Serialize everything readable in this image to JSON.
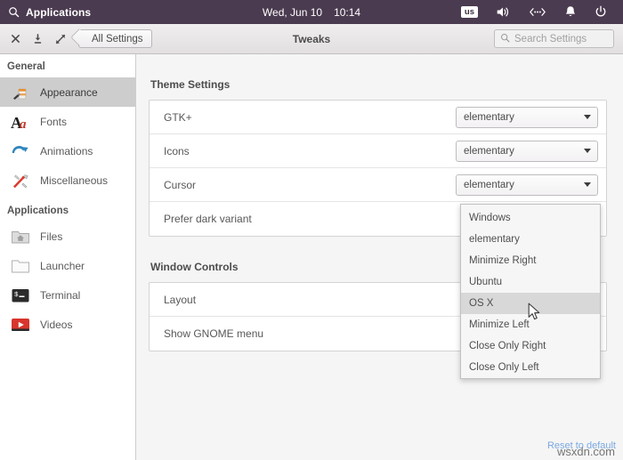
{
  "topbar": {
    "apps_icon": "search-icon",
    "apps_label": "Applications",
    "date": "Wed, Jun 10",
    "time": "10:14",
    "keyboard_layout": "us",
    "tray_icons": [
      "volume-icon",
      "network-icon",
      "bell-icon",
      "power-icon"
    ],
    "bg_color": "#4b3b50"
  },
  "titlebar": {
    "close_icon": "close-icon",
    "minimize_icon": "minimize-icon",
    "maximize_icon": "maximize-icon",
    "back_label": "All Settings",
    "title": "Tweaks",
    "search_placeholder": "Search Settings",
    "search_value": "",
    "search_icon": "search-icon"
  },
  "sidebar": {
    "groups": [
      {
        "heading": "General",
        "items": [
          {
            "label": "Appearance",
            "icon": "paintbrush-icon",
            "selected": true
          },
          {
            "label": "Fonts",
            "icon": "font-aa-icon",
            "selected": false
          },
          {
            "label": "Animations",
            "icon": "curved-arrow-icon",
            "selected": false
          },
          {
            "label": "Miscellaneous",
            "icon": "swiss-knife-icon",
            "selected": false
          }
        ]
      },
      {
        "heading": "Applications",
        "items": [
          {
            "label": "Files",
            "icon": "home-folder-icon",
            "selected": false
          },
          {
            "label": "Launcher",
            "icon": "folder-icon",
            "selected": false
          },
          {
            "label": "Terminal",
            "icon": "terminal-icon",
            "selected": false
          },
          {
            "label": "Videos",
            "icon": "play-button-icon",
            "selected": false
          }
        ]
      }
    ]
  },
  "main": {
    "sections": [
      {
        "title": "Theme Settings",
        "rows": [
          {
            "label": "GTK+",
            "control": "combo",
            "value": "elementary"
          },
          {
            "label": "Icons",
            "control": "combo",
            "value": "elementary"
          },
          {
            "label": "Cursor",
            "control": "combo",
            "value": "elementary"
          },
          {
            "label": "Prefer dark variant",
            "control": "hidden",
            "value": ""
          }
        ]
      },
      {
        "title": "Window Controls",
        "rows": [
          {
            "label": "Layout",
            "control": "hidden",
            "value": ""
          },
          {
            "label": "Show GNOME menu",
            "control": "hidden",
            "value": ""
          }
        ]
      }
    ],
    "reset_label": "Reset to default",
    "reset_color": "#7aa8e0",
    "watermark": "wsxdn.com"
  },
  "dropdown": {
    "open": true,
    "items": [
      {
        "label": "Windows",
        "highlighted": false
      },
      {
        "label": "elementary",
        "highlighted": false
      },
      {
        "label": "Minimize Right",
        "highlighted": false
      },
      {
        "label": "Ubuntu",
        "highlighted": false
      },
      {
        "label": "OS X",
        "highlighted": true
      },
      {
        "label": "Minimize Left",
        "highlighted": false
      },
      {
        "label": "Close Only Right",
        "highlighted": false
      },
      {
        "label": "Close Only Left",
        "highlighted": false
      }
    ]
  }
}
